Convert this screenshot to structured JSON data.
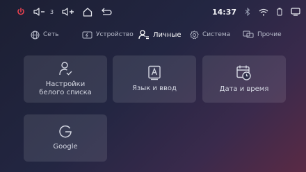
{
  "status_bar": {
    "volume_level": "3",
    "time": "14:37",
    "icons": [
      "power-icon",
      "volume-down-icon",
      "volume-up-icon",
      "home-icon",
      "back-icon",
      "bluetooth-icon",
      "wifi-icon",
      "battery-icon",
      "recent-apps-icon"
    ]
  },
  "tabs": [
    {
      "label": "Сеть",
      "icon": "globe-icon",
      "active": false
    },
    {
      "label": "Устройство",
      "icon": "device-icon",
      "active": false
    },
    {
      "label": "Личные",
      "icon": "user-icon",
      "active": true
    },
    {
      "label": "Система",
      "icon": "gear-icon",
      "active": false
    },
    {
      "label": "Прочие",
      "icon": "screens-icon",
      "active": false
    }
  ],
  "tiles": [
    {
      "label_line1": "Настройки",
      "label_line2": "белого списка",
      "icon": "user-check-icon"
    },
    {
      "label": "Язык и ввод",
      "icon": "language-a-icon"
    },
    {
      "label": "Дата и время",
      "icon": "calendar-clock-icon"
    },
    {
      "label": "Google",
      "icon": "google-g-icon"
    }
  ],
  "colors": {
    "power": "#e8414f",
    "active_tab": "#ffffff",
    "inactive_tab": "#b8bccb"
  }
}
